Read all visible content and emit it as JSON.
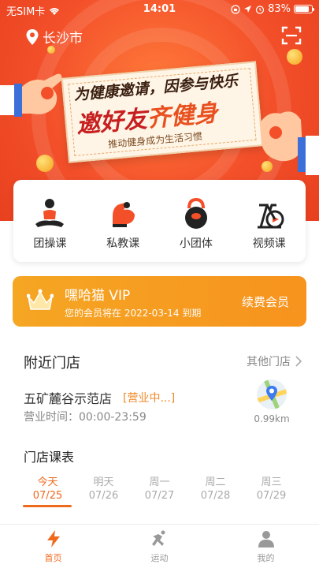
{
  "status_bar": {
    "carrier": "无SIM卡",
    "time": "14:01",
    "battery": "83%",
    "battery_level": 0.83,
    "icons": [
      "wifi-icon",
      "orientation-lock-icon",
      "location-arrow-icon",
      "alarm-icon",
      "battery-icon"
    ]
  },
  "header": {
    "city": "长沙市",
    "scan_icon": "scan-icon"
  },
  "banner": {
    "line1": "为健康邀请，因参与快乐",
    "line2_a": "邀好友",
    "line2_b": "齐健身",
    "line3": "推动健身成为生活习惯"
  },
  "categories": [
    {
      "label": "团操课",
      "icon": "yoga-icon"
    },
    {
      "label": "私教课",
      "icon": "muscle-arm-icon"
    },
    {
      "label": "小团体",
      "icon": "kettlebell-icon"
    },
    {
      "label": "视频课",
      "icon": "spin-bike-icon"
    }
  ],
  "vip": {
    "title": "嘿哈猫 VIP",
    "subtitle": "您的会员将在 2022-03-14 到期",
    "renew": "续费会员"
  },
  "nearby": {
    "title": "附近门店",
    "other": "其他门店",
    "store_name": "五矿麓谷示范店",
    "store_status": "[营业中...]",
    "hours": "营业时间：00:00-23:59",
    "distance": "0.99km"
  },
  "schedule": {
    "title": "门店课表",
    "dates": [
      {
        "day": "今天",
        "date": "07/25",
        "active": true
      },
      {
        "day": "明天",
        "date": "07/26",
        "active": false
      },
      {
        "day": "周一",
        "date": "07/27",
        "active": false
      },
      {
        "day": "周二",
        "date": "07/28",
        "active": false
      },
      {
        "day": "周三",
        "date": "07/29",
        "active": false
      }
    ]
  },
  "tabbar": [
    {
      "label": "首页",
      "icon": "lightning-icon",
      "active": true
    },
    {
      "label": "运动",
      "icon": "running-icon",
      "active": false
    },
    {
      "label": "我的",
      "icon": "person-icon",
      "active": false
    }
  ],
  "colors": {
    "accent": "#f06a1e",
    "banner": "#f3502a",
    "vip": "#f5a623",
    "status_open": "#f08a2a"
  }
}
